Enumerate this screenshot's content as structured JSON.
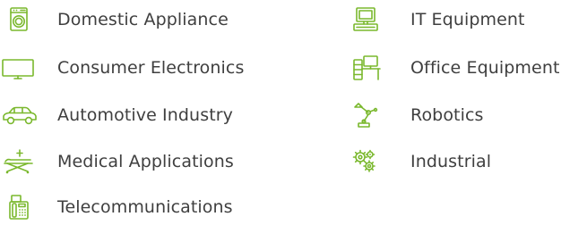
{
  "accent_color": "#7ab82d",
  "text_color": "#3f3f3f",
  "left_column": [
    {
      "label": "Domestic Appliance",
      "icon": "washing-machine-icon"
    },
    {
      "label": "Consumer Electronics",
      "icon": "tv-monitor-icon"
    },
    {
      "label": "Automotive Industry",
      "icon": "car-icon"
    },
    {
      "label": "Medical Applications",
      "icon": "medical-bed-icon"
    },
    {
      "label": "Telecommunications",
      "icon": "fax-phone-icon"
    }
  ],
  "right_column": [
    {
      "label": "IT Equipment",
      "icon": "computer-icon"
    },
    {
      "label": "Office Equipment",
      "icon": "office-desk-icon"
    },
    {
      "label": "Robotics",
      "icon": "robot-arm-icon"
    },
    {
      "label": "Industrial",
      "icon": "gears-icon"
    }
  ]
}
